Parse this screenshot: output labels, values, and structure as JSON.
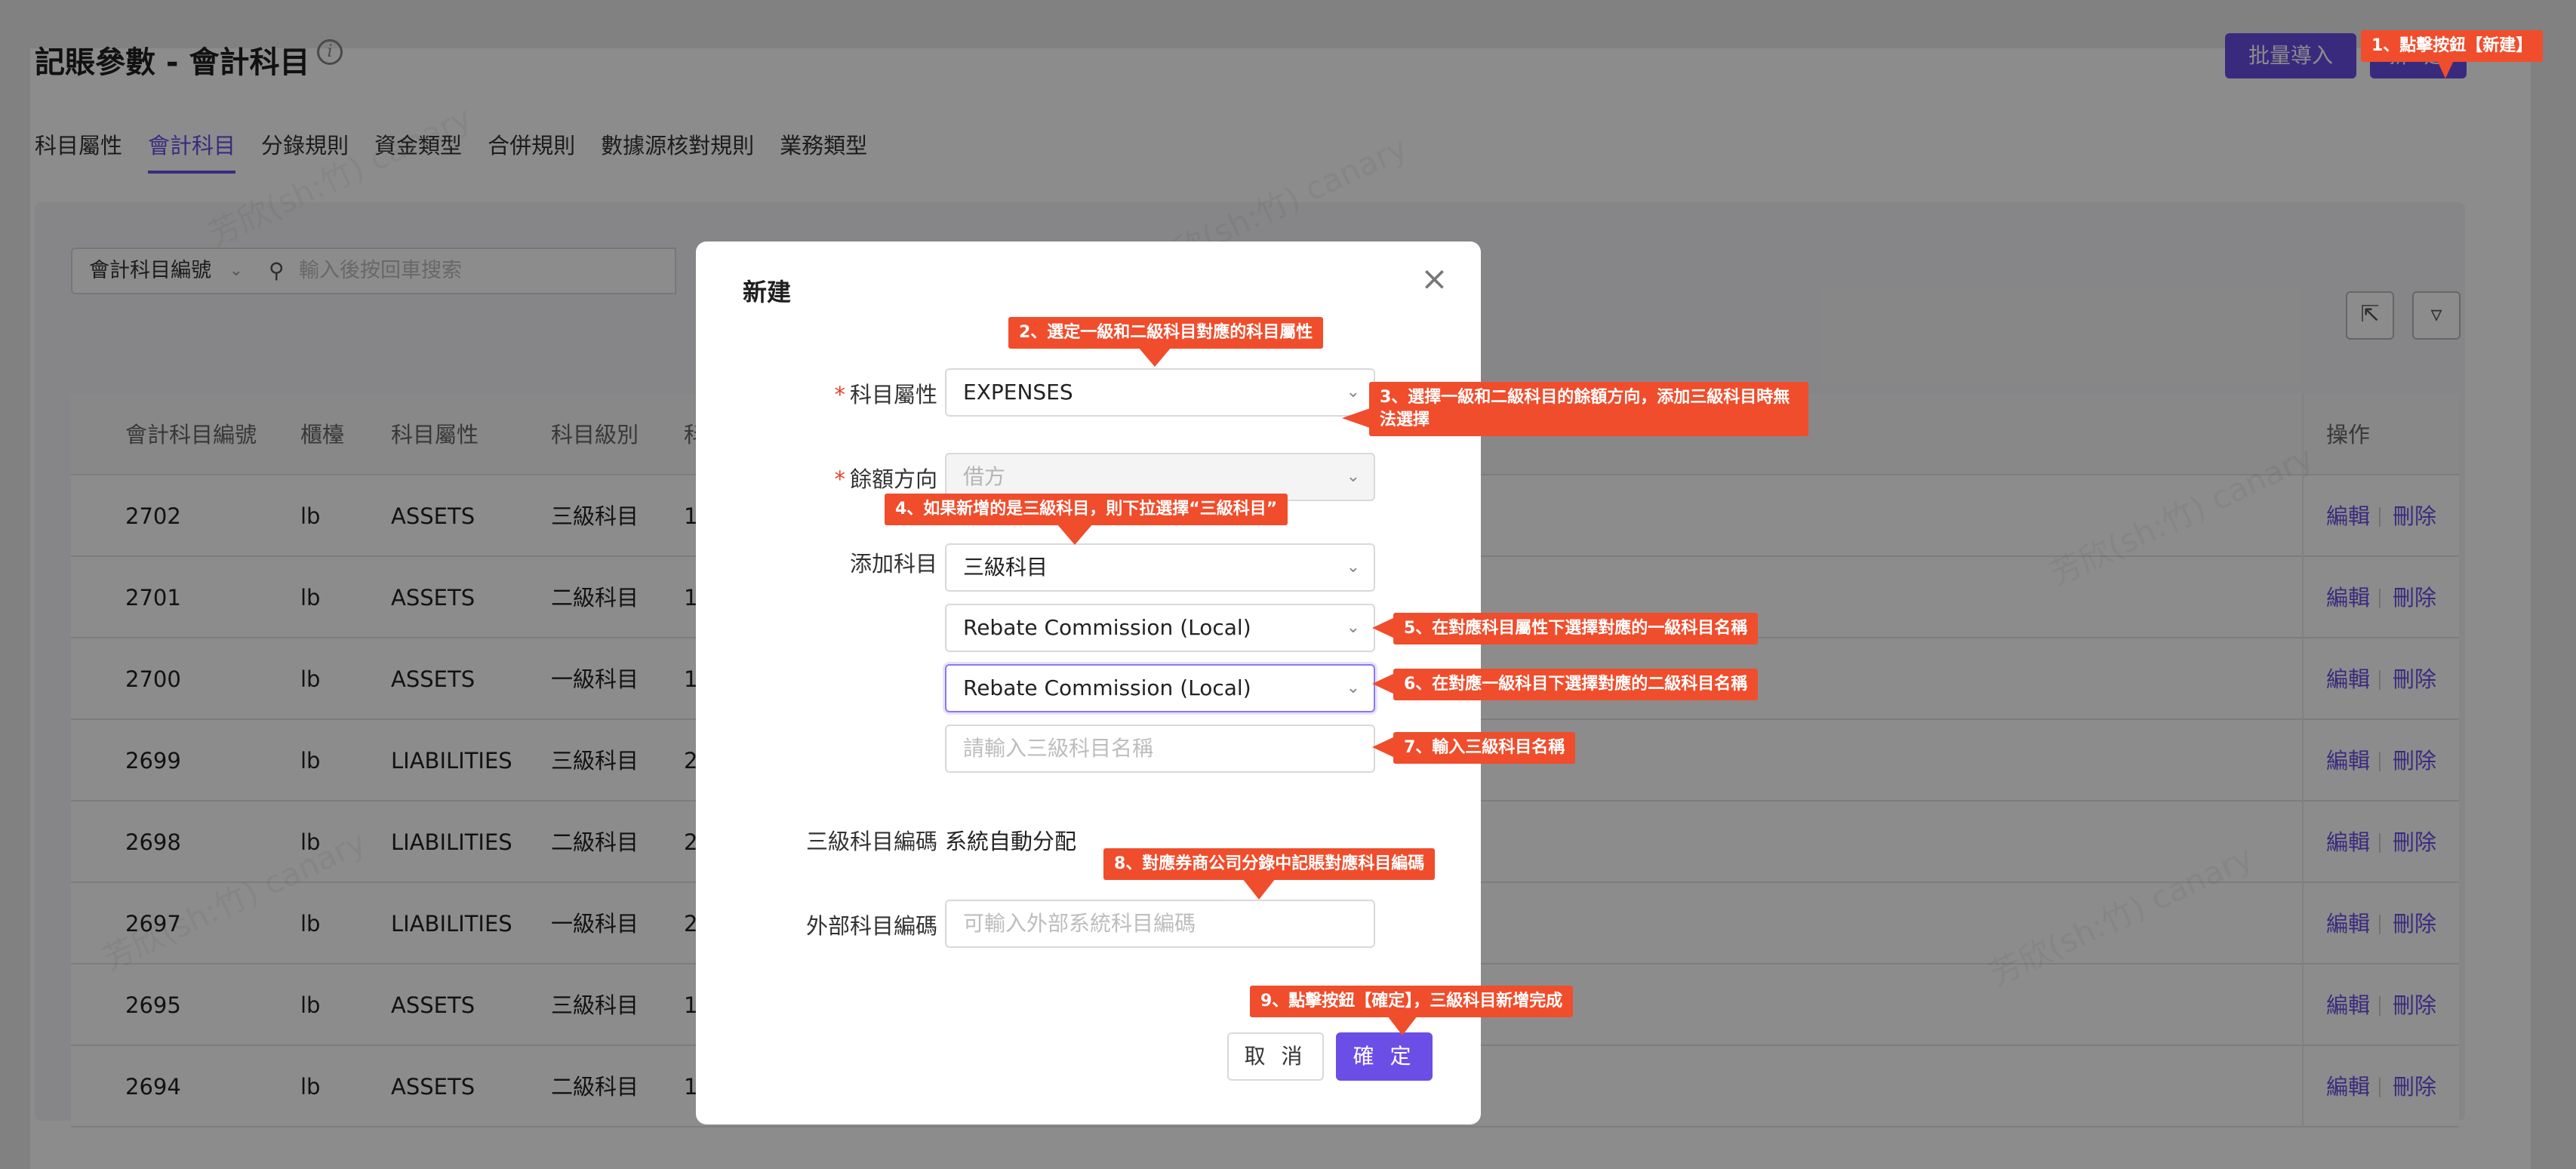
{
  "page": {
    "title": "記賬參數 - 會計科目",
    "info_icon": "info-icon",
    "batch_import_label": "批量導入",
    "new_label": "新 建",
    "tabs": [
      "科目屬性",
      "會計科目",
      "分錄規則",
      "資金類型",
      "合併規則",
      "數據源核對規則",
      "業務類型"
    ],
    "active_tab": "會計科目"
  },
  "search": {
    "field_label": "會計科目編號",
    "placeholder": "輸入後按回車搜索"
  },
  "toolbar": {
    "export_icon": "export-icon",
    "filter_icon": "filter-icon"
  },
  "table": {
    "headers": [
      "會計科目編號",
      "櫃檯",
      "科目屬性",
      "科目級別",
      "科"
    ],
    "op_header": "操作",
    "edit_label": "編輯",
    "delete_label": "刪除",
    "rows": [
      [
        "2702",
        "lb",
        "ASSETS",
        "三級科目",
        "1"
      ],
      [
        "2701",
        "lb",
        "ASSETS",
        "二級科目",
        "1"
      ],
      [
        "2700",
        "lb",
        "ASSETS",
        "一級科目",
        "1"
      ],
      [
        "2699",
        "lb",
        "LIABILITIES",
        "三級科目",
        "2"
      ],
      [
        "2698",
        "lb",
        "LIABILITIES",
        "二級科目",
        "2"
      ],
      [
        "2697",
        "lb",
        "LIABILITIES",
        "一級科目",
        "2"
      ],
      [
        "2695",
        "lb",
        "ASSETS",
        "三級科目",
        "1"
      ],
      [
        "2694",
        "lb",
        "ASSETS",
        "二級科目",
        "1"
      ]
    ]
  },
  "watermark": "芳欣(sh:竹) canary",
  "modal": {
    "title": "新建",
    "close_icon": "close-icon",
    "fields": {
      "account_attribute": {
        "label": "科目屬性",
        "value": "EXPENSES"
      },
      "balance_direction": {
        "label": "餘額方向",
        "value": "借方"
      },
      "add_account": {
        "label": "添加科目",
        "level_value": "三級科目",
        "level1_value": "Rebate Commission (Local)",
        "level2_value": "Rebate Commission (Local)",
        "level3_placeholder": "請輸入三級科目名稱"
      },
      "level3_code": {
        "label": "三級科目編碼",
        "value": "系統自動分配"
      },
      "external_code": {
        "label": "外部科目編碼",
        "placeholder": "可輸入外部系統科目編碼"
      }
    },
    "cancel_label": "取 消",
    "ok_label": "確 定"
  },
  "callouts": [
    "1、點擊按鈕【新建】",
    "2、選定一級和二級科目對應的科目屬性",
    "3、選擇一級和二級科目的餘額方向，添加三級科目時無法選擇",
    "4、如果新增的是三級科目，則下拉選擇“三級科目”",
    "5、在對應科目屬性下選擇對應的一級科目名稱",
    "6、在對應一級科目下選擇對應的二級科目名稱",
    "7、輸入三級科目名稱",
    "8、對應券商公司分錄中記賬對應科目編碼",
    "9、點擊按鈕【確定】，三級科目新增完成"
  ],
  "colors": {
    "primary": "#6b4ee6",
    "callout": "#f04d2c",
    "required": "#e5442c"
  }
}
